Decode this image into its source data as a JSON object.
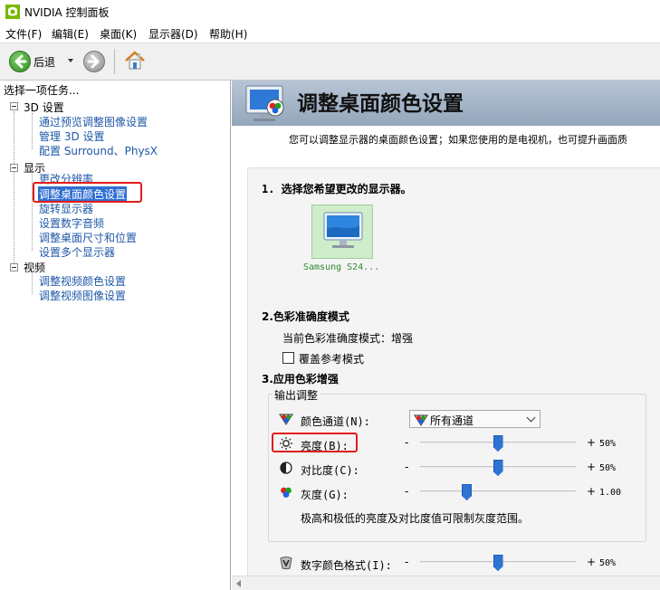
{
  "window": {
    "title": "NVIDIA 控制面板"
  },
  "menubar": {
    "items": [
      "文件(F)",
      "编辑(E)",
      "桌面(K)",
      "显示器(D)",
      "帮助(H)"
    ]
  },
  "toolbar": {
    "back_label": "后退",
    "icons": [
      "back-arrow-icon",
      "forward-arrow-icon",
      "home-icon"
    ]
  },
  "sidebar": {
    "heading": "选择一项任务...",
    "categories": [
      {
        "label": "3D 设置",
        "items": [
          "通过预览调整图像设置",
          "管理 3D 设置",
          "配置 Surround、PhysX"
        ]
      },
      {
        "label": "显示",
        "items": [
          "更改分辨率",
          "调整桌面颜色设置",
          "旋转显示器",
          "设置数字音频",
          "调整桌面尺寸和位置",
          "设置多个显示器"
        ]
      },
      {
        "label": "视频",
        "items": [
          "调整视频颜色设置",
          "调整视频图像设置"
        ]
      }
    ],
    "selected_item": "调整桌面颜色设置"
  },
  "main": {
    "title": "调整桌面颜色设置",
    "description": "您可以调整显示器的桌面颜色设置；如果您使用的是电视机，也可提升画面质",
    "section1": {
      "title": "1. 选择您希望更改的显示器。",
      "monitor_label": "Samsung S24..."
    },
    "section2": {
      "title": "2.色彩准确度模式",
      "current_mode_label": "当前色彩准确度模式：增强",
      "override_checkbox_label": "覆盖参考模式",
      "override_checked": false
    },
    "section3": {
      "title": "3.应用色彩增强",
      "group_label": "输出调整",
      "channel_label": "颜色通道(N):",
      "channel_value": "所有通道",
      "brightness_label": "亮度(B):",
      "brightness_value": "50%",
      "brightness_level": 0.5,
      "contrast_label": "对比度(C):",
      "contrast_value": "50%",
      "contrast_level": 0.5,
      "gamma_label": "灰度(G):",
      "gamma_value": "1.00",
      "gamma_level": 0.3,
      "note": "极高和极低的亮度及对比度值可限制灰度范围。",
      "digital_format_label": "数字颜色格式(I):",
      "digital_format_value": "50%",
      "digital_format_level": 0.5,
      "minus": "-",
      "plus": "+"
    }
  },
  "colors": {
    "accent_blue": "#2f6ed1",
    "link_blue": "#1e58a8",
    "highlight_red": "#e31b1b",
    "nvidia_green": "#76b900"
  }
}
